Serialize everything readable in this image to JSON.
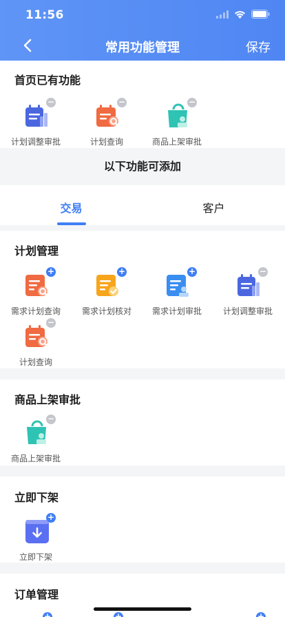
{
  "status": {
    "time": "11:56"
  },
  "nav": {
    "title": "常用功能管理",
    "save": "保存"
  },
  "home_section": {
    "title": "首页已有功能",
    "items": [
      {
        "label": "计划调整审批"
      },
      {
        "label": "计划查询"
      },
      {
        "label": "商品上架审批"
      }
    ]
  },
  "add_banner": "以下功能可添加",
  "tabs": [
    {
      "label": "交易"
    },
    {
      "label": "客户"
    }
  ],
  "plan_section": {
    "title": "计划管理",
    "items": [
      {
        "label": "需求计划查询"
      },
      {
        "label": "需求计划核对"
      },
      {
        "label": "需求计划审批"
      },
      {
        "label": "计划调整审批"
      },
      {
        "label": "计划查询"
      }
    ]
  },
  "shelf_section": {
    "title": "商品上架审批",
    "items": [
      {
        "label": "商品上架审批"
      }
    ]
  },
  "off_section": {
    "title": "立即下架",
    "items": [
      {
        "label": "立即下架"
      }
    ]
  },
  "order_section": {
    "title": "订单管理"
  },
  "colors": {
    "brand": "#4f86f3",
    "badge_add": "#3f7ef5",
    "badge_remove": "#c4c6cc"
  }
}
